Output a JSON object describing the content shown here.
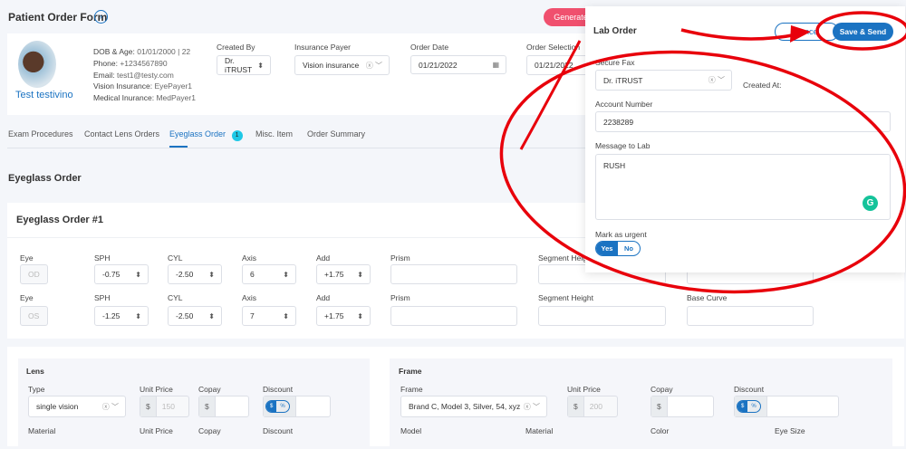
{
  "header": {
    "title": "Patient Order Form",
    "generate_label": "Generate"
  },
  "patient": {
    "name": "Test testivino",
    "dob_label": "DOB & Age:",
    "dob": "01/01/2000 | 22",
    "phone_label": "Phone:",
    "phone": "+1234567890",
    "email_label": "Email:",
    "email": "test1@testy.com",
    "vision_label": "Vision Insurance:",
    "vision": "EyePayer1",
    "medical_label": "Medical Inurance:",
    "medical": "MedPayer1"
  },
  "order": {
    "created_by_label": "Created By",
    "created_by": "Dr. iTRUST",
    "payer_label": "Insurance Payer",
    "payer": "Vision insurance",
    "date_label": "Order Date",
    "date": "01/21/2022",
    "selection_label": "Order Selection",
    "selection": "01/21/2022"
  },
  "tabs": [
    {
      "label": "Exam Procedures"
    },
    {
      "label": "Contact Lens Orders"
    },
    {
      "label": "Eyeglass Order",
      "badge": "1"
    },
    {
      "label": "Misc. Item"
    },
    {
      "label": "Order Summary"
    }
  ],
  "section_title": "Eyeglass Order",
  "card_title": "Eyeglass Order #1",
  "rx_labels": {
    "eye": "Eye",
    "sph": "SPH",
    "cyl": "CYL",
    "axis": "Axis",
    "add": "Add",
    "prism": "Prism",
    "seg": "Segment Height",
    "base": "Base Curve"
  },
  "rx_rows": [
    {
      "eye": "OD",
      "sph": "-0.75",
      "cyl": "-2.50",
      "axis": "6",
      "add": "+1.75"
    },
    {
      "eye": "OS",
      "sph": "-1.25",
      "cyl": "-2.50",
      "axis": "7",
      "add": "+1.75"
    }
  ],
  "lens": {
    "title": "Lens",
    "type_label": "Type",
    "type": "single vision",
    "unit_label": "Unit Price",
    "unit": "150",
    "copay_label": "Copay",
    "discount_label": "Discount",
    "currency": "$",
    "pct": "%",
    "material_label": "Material"
  },
  "frame": {
    "title": "Frame",
    "frame_label": "Frame",
    "frame": "Brand C, Model 3, Silver, 54, xyz",
    "unit_label": "Unit Price",
    "unit": "200",
    "copay_label": "Copay",
    "discount_label": "Discount",
    "model_label": "Model",
    "material_label": "Material",
    "color_label": "Color",
    "eye_size_label": "Eye Size"
  },
  "modal": {
    "title": "Lab Order",
    "cancel": "Cancel",
    "save": "Save & Send",
    "fax_label": "Secure Fax",
    "fax": "Dr. iTRUST",
    "created_at": "Created At:",
    "account_label": "Account Number",
    "account": "2238289",
    "message_label": "Message to Lab",
    "message": "RUSH",
    "urgent_label": "Mark as urgent",
    "yes": "Yes",
    "no": "No"
  },
  "colors": {
    "accent": "#1b73c2",
    "annotation": "#e8000b",
    "generate": "#f0506e",
    "badge": "#1ec8e6"
  }
}
